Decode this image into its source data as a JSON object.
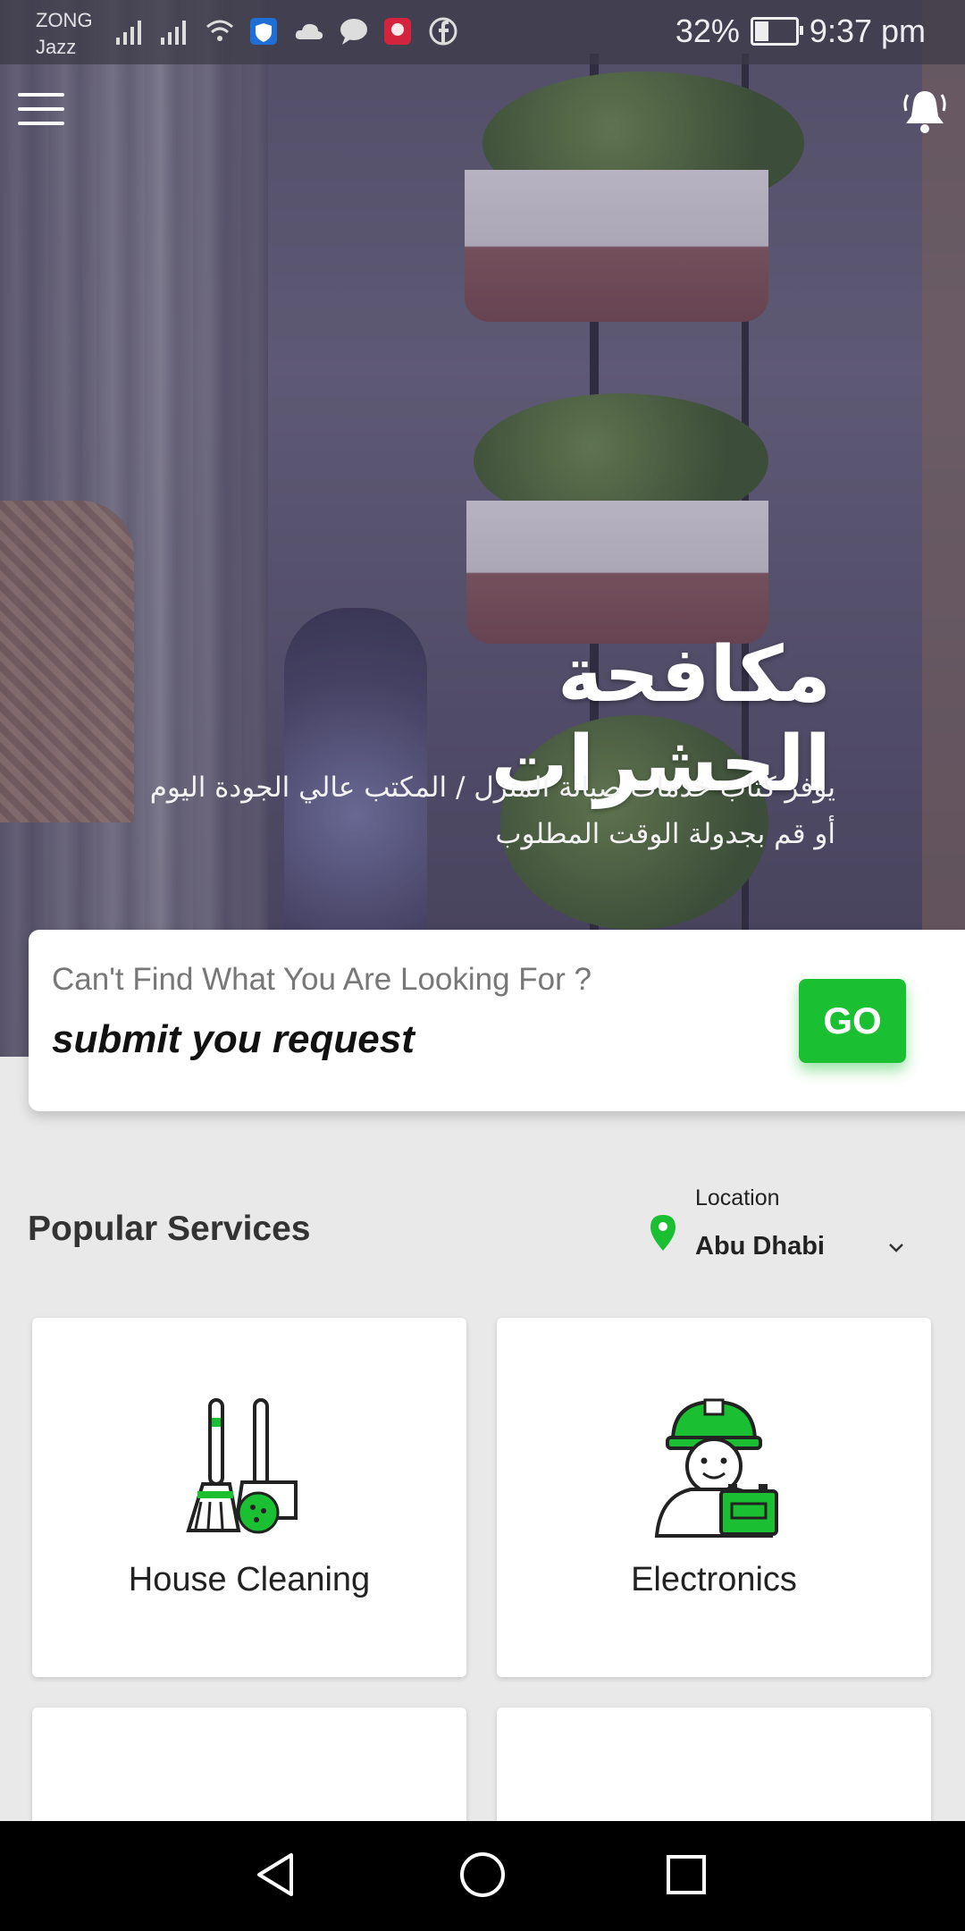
{
  "status_bar": {
    "carrier_line1": "ZONG",
    "carrier_line2": "Jazz",
    "battery": "32%",
    "time": "9:37 pm",
    "icons": [
      "signal-icon",
      "signal-icon",
      "wifi-icon",
      "shield-icon",
      "cloud-icon",
      "chat-icon",
      "huawei-icon",
      "facebook-icon"
    ]
  },
  "header": {
    "menu_icon": "hamburger-menu-icon",
    "notification_icon": "bell-icon"
  },
  "hero": {
    "title": "مكافحة الحشرات",
    "subtitle_line1": "يوفر كتاب خدمات صيانة المنزل / المكتب عالي الجودة اليوم",
    "subtitle_line2": "أو قم بجدولة الوقت المطلوب"
  },
  "request_card": {
    "question": "Can't Find What You Are Looking For ?",
    "cta_text": "submit you request",
    "button_label": "GO"
  },
  "services": {
    "section_title": "Popular Services",
    "location_label": "Location",
    "location_value": "Abu Dhabi",
    "items": [
      {
        "name": "House Cleaning",
        "icon": "broom-dustpan-icon"
      },
      {
        "name": "Electronics",
        "icon": "technician-icon"
      },
      {
        "name": "",
        "icon": "spray-icon"
      },
      {
        "name": "",
        "icon": "tools-icon"
      }
    ]
  },
  "colors": {
    "accent": "#1bc032",
    "text_dark": "#222222",
    "background": "#e9e9e9"
  },
  "nav_bar": {
    "icons": [
      "back-icon",
      "home-icon",
      "recents-icon"
    ]
  }
}
